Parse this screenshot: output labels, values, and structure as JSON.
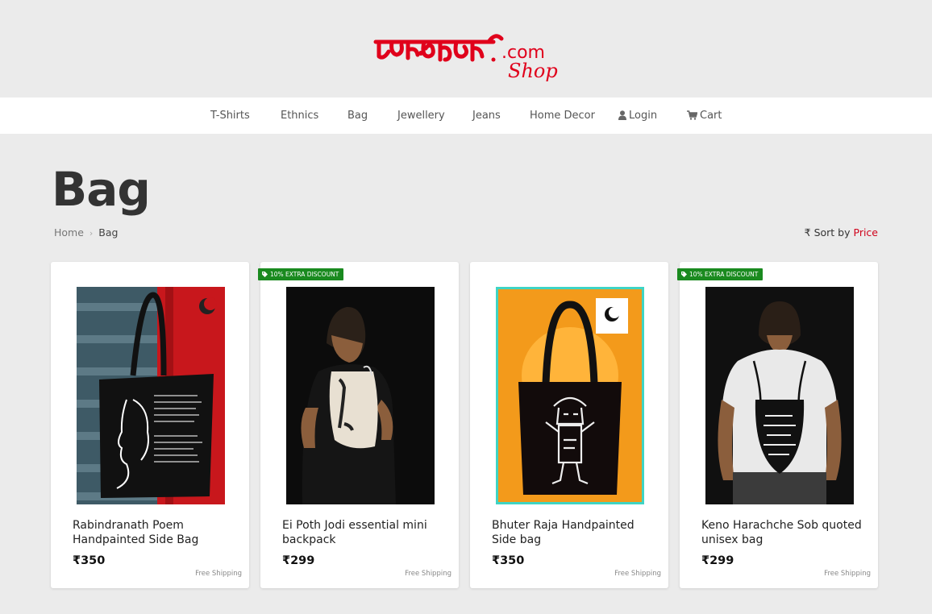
{
  "header": {
    "logo_bengali_text": "পরবাঙালি",
    "logo_com": ".com",
    "logo_shop": "Shop"
  },
  "nav": {
    "items": [
      {
        "label": "T-Shirts"
      },
      {
        "label": "Ethnics"
      },
      {
        "label": "Bag"
      },
      {
        "label": "Jewellery"
      },
      {
        "label": "Jeans"
      },
      {
        "label": "Home Decor"
      },
      {
        "label": "Login",
        "icon": "user-icon"
      },
      {
        "label": "Cart",
        "icon": "cart-icon"
      }
    ]
  },
  "page": {
    "title": "Bag",
    "breadcrumb": {
      "home": "Home",
      "separator": "›",
      "current": "Bag"
    },
    "sort": {
      "currency_symbol": "₹",
      "label": "Sort by",
      "value": "Price"
    }
  },
  "products": [
    {
      "name": "Rabindranath Poem Handpainted Side Bag",
      "price": "₹350",
      "shipping": "Free Shipping",
      "badge": ""
    },
    {
      "name": "Ei Poth Jodi essential mini backpack",
      "price": "₹299",
      "shipping": "Free Shipping",
      "badge": "10% EXTRA DISCOUNT"
    },
    {
      "name": "Bhuter Raja Handpainted Side bag",
      "price": "₹350",
      "shipping": "Free Shipping",
      "badge": ""
    },
    {
      "name": "Keno Harachche Sob quoted unisex bag",
      "price": "₹299",
      "shipping": "Free Shipping",
      "badge": "10% EXTRA DISCOUNT"
    }
  ],
  "colors": {
    "brand_red": "#e0001b",
    "accent_red": "#d0021b",
    "badge_green": "#1a8a1f",
    "page_bg": "#ebebeb"
  }
}
